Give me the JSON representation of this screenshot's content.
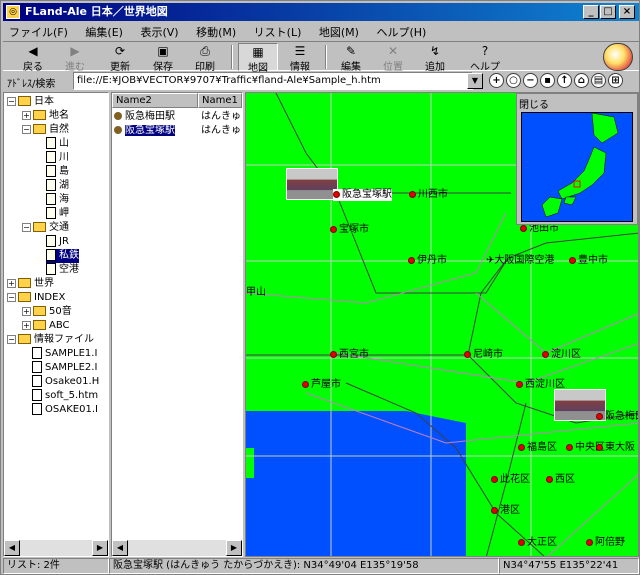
{
  "window": {
    "title": "FLand-Ale 日本／世界地図",
    "app_icon": "globe-icon"
  },
  "menu": [
    "ファイル(F)",
    "編集(E)",
    "表示(V)",
    "移動(M)",
    "リスト(L)",
    "地図(M)",
    "ヘルプ(H)"
  ],
  "toolbar": {
    "back": "戻る",
    "forward": "進む",
    "refresh": "更新",
    "save": "保存",
    "print": "印刷",
    "map": "地図",
    "info": "情報",
    "edit": "編集",
    "position": "位置",
    "add": "追加",
    "help": "ヘルプ"
  },
  "address": {
    "label": "ｱﾄﾞﾚｽ/検索",
    "value": "file://E:¥JOB¥VECTOR¥9707¥Traffic¥fland-Ale¥Sample_h.htm"
  },
  "tree": {
    "japan": "日本",
    "placename": "地名",
    "nature": "自然",
    "mountain": "山",
    "river": "川",
    "island": "島",
    "lake": "湖",
    "sea": "海",
    "cape": "岬",
    "traffic": "交通",
    "jr": "JR",
    "private_rail": "私鉄",
    "airport": "空港",
    "world": "世界",
    "index": "INDEX",
    "gojuon": "50音",
    "abc": "ABC",
    "infofile": "情報ファイル",
    "f1": "SAMPLE1.I",
    "f2": "SAMPLE2.I",
    "f3": "Osake01.H",
    "f4": "soft_5.htm",
    "f5": "OSAKE01.I"
  },
  "list": {
    "col1": "Name2",
    "col2": "Name1",
    "rows": [
      {
        "name2": "阪急梅田駅",
        "name1": "はんきゅ"
      },
      {
        "name2": "阪急宝塚駅",
        "name1": "はんきゅ"
      }
    ]
  },
  "map": {
    "inset_close": "閉じる",
    "cities": {
      "takarazuka_sta": "阪急宝塚駅",
      "kawanishi": "川西市",
      "takarazuka": "宝塚市",
      "ikeda": "池田市",
      "itami": "伊丹市",
      "osaka_airport": "大阪国際空港",
      "toyonaka": "豊中市",
      "nishinomiya": "西宮市",
      "amagasaki": "尼崎市",
      "yodogawa": "淀川区",
      "ashiya": "芦屋市",
      "nishiyodogawa": "西淀川区",
      "umeda": "阪急梅田",
      "fukushima": "福島区",
      "chuo": "中央区",
      "higashiosaka": "東大阪",
      "konohana": "此花区",
      "minato": "港区",
      "nishi": "西区",
      "taisho": "大正区",
      "abeno": "阿倍野",
      "rokko": "甲山"
    },
    "colors": {
      "land": "#00ff00",
      "sea": "#0050ff",
      "station_dot": "#e00000"
    }
  },
  "status": {
    "count": "リスト: 2件",
    "detail": "阪急宝塚駅 (はんきゅう たからづかえき): N34°49'04 E135°19'58",
    "coords": "N34°47'55 E135°22'41"
  }
}
